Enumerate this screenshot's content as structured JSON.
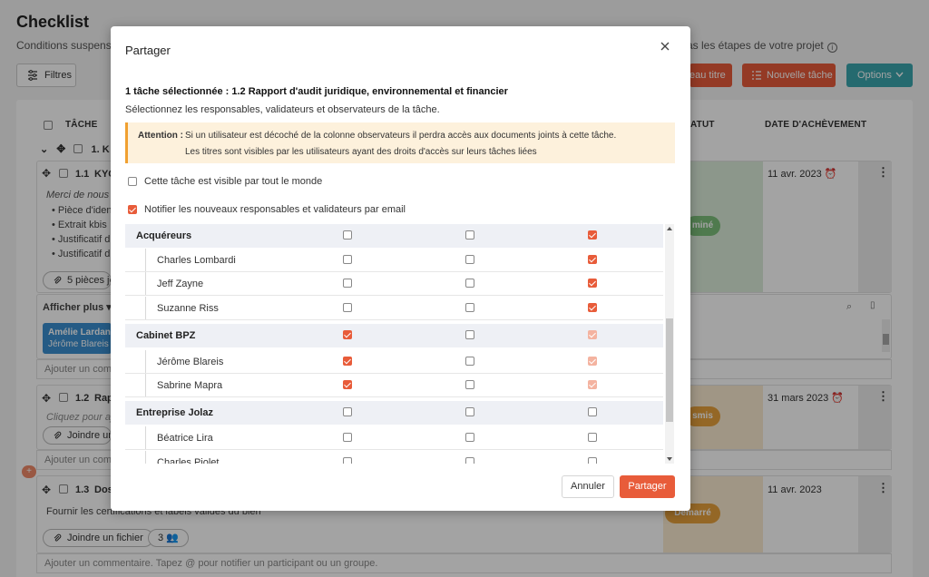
{
  "colors": {
    "accent": "#e85c3a",
    "options": "#3ba6ae",
    "warning_bg": "#fdf1dc",
    "warning_border": "#f0a030",
    "done_status": "#7cbf7a",
    "sent_status": "#e8a23c"
  },
  "background": {
    "title": "Checklist",
    "subtitle_left": "Conditions suspens",
    "subtitle_right": "as les étapes de votre projet",
    "filters_label": "Filtres",
    "new_title_label": "eau titre",
    "new_task_label": "Nouvelle tâche",
    "options_label": "Options",
    "columns": {
      "task": "TÂCHE",
      "status": "ATUT",
      "completion": "DATE D'ACHÈVEMENT"
    },
    "group": "1. K",
    "task1": {
      "number": "1.1",
      "name": "KYC",
      "description": "Merci de nous fo",
      "bullets": [
        "Pièce d'iden",
        "Extrait kbis",
        "Justificatif d",
        "Justificatif d"
      ],
      "attachments": "5 pièces joi",
      "show_more": "Afficher plus",
      "assignee_name": "Amélie Lardant",
      "assignee_sub": "Jérôme Blareis",
      "status": "miné",
      "date": "11 avr. 2023",
      "comment": "Ajouter un comme"
    },
    "task2": {
      "number": "1.2",
      "name": "Rap",
      "hint": "Cliquez pour ajo",
      "join": "Joindre un",
      "status": "smis",
      "date": "31 mars 2023",
      "comment": "Ajouter un comme"
    },
    "task3": {
      "number": "1.3",
      "name": "Dos",
      "description": "Fournir les certifications et labels validés du bien",
      "join": "Joindre un fichier",
      "participants": "3",
      "status": "Démarré",
      "date": "11 avr. 2023",
      "comment": "Ajouter un commentaire. Tapez @ pour notifier un participant ou un groupe."
    }
  },
  "modal": {
    "title": "Partager",
    "heading": "1 tâche sélectionnée : 1.2 Rapport d'audit juridique, environnemental et financier",
    "subheading": "Sélectionnez les responsables, validateurs et observateurs de la tâche.",
    "alert": {
      "label": "Attention :",
      "line1": "Si un utilisateur est décoché de la colonne observateurs il perdra accès aux documents joints à cette tâche.",
      "line2": "Les titres sont visibles par les utilisateurs ayant des droits d'accès sur leurs tâches liées"
    },
    "option_visible": {
      "label": "Cette tâche est visible par tout le monde",
      "checked": false
    },
    "option_notify": {
      "label": "Notifier les nouveaux responsables et validateurs par email",
      "checked": true
    },
    "rows": [
      {
        "type": "group",
        "name": "Acquéreurs",
        "checks": [
          "off",
          "off",
          "on"
        ]
      },
      {
        "type": "member",
        "name": "Charles Lombardi",
        "checks": [
          "off",
          "off",
          "on"
        ]
      },
      {
        "type": "member",
        "name": "Jeff Zayne",
        "checks": [
          "off",
          "off",
          "on"
        ]
      },
      {
        "type": "member",
        "name": "Suzanne Riss",
        "checks": [
          "off",
          "off",
          "on"
        ]
      },
      {
        "type": "group",
        "name": "Cabinet BPZ",
        "checks": [
          "on",
          "off",
          "dim"
        ]
      },
      {
        "type": "member",
        "name": "Jérôme Blareis",
        "checks": [
          "on",
          "off",
          "dim"
        ]
      },
      {
        "type": "member",
        "name": "Sabrine Mapra",
        "checks": [
          "on",
          "off",
          "dim"
        ]
      },
      {
        "type": "group",
        "name": "Entreprise Jolaz",
        "checks": [
          "off",
          "off",
          "off"
        ]
      },
      {
        "type": "member",
        "name": "Béatrice Lira",
        "checks": [
          "off",
          "off",
          "off"
        ]
      },
      {
        "type": "member",
        "name": "Charles Piolet",
        "checks": [
          "off",
          "off",
          "off"
        ]
      }
    ],
    "cancel_label": "Annuler",
    "share_label": "Partager"
  }
}
